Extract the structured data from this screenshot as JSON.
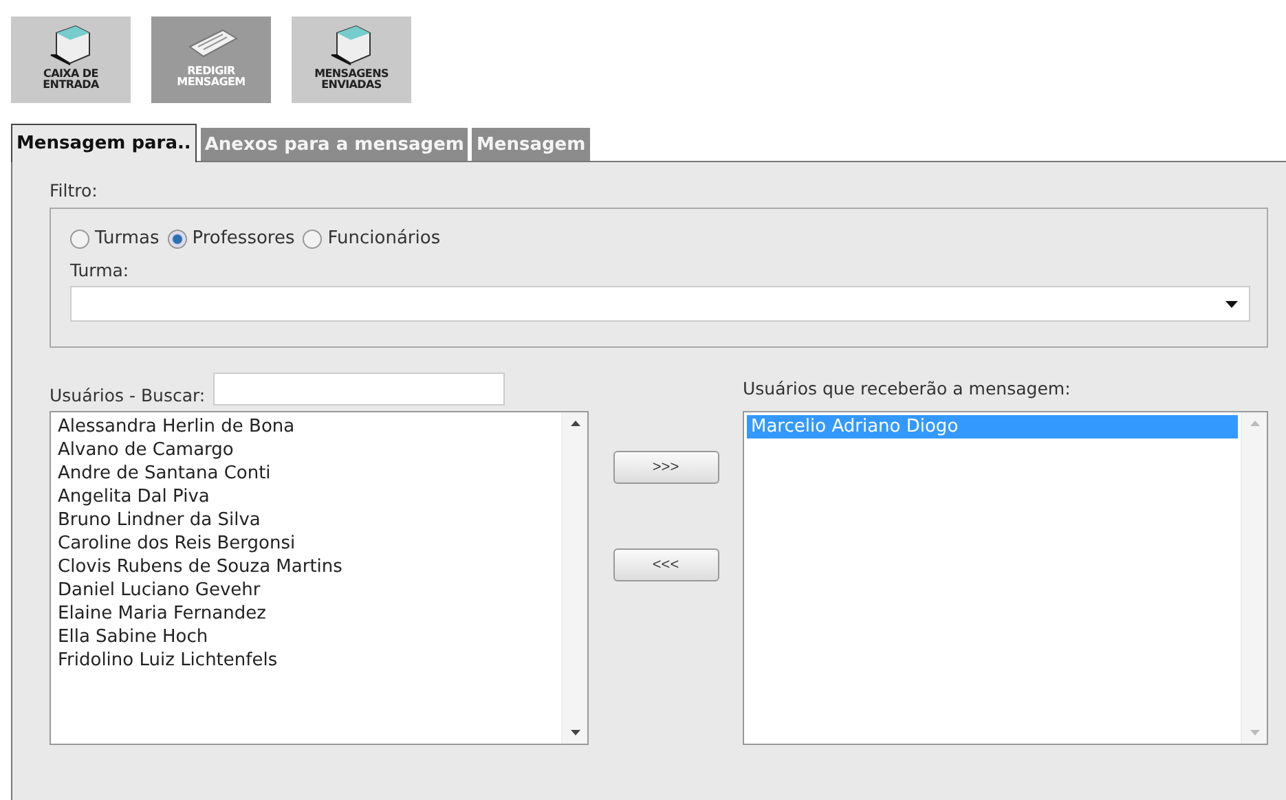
{
  "toolbar": [
    {
      "label": "CAIXA DE ENTRADA",
      "kind": "inbox",
      "disabled": false
    },
    {
      "label": "REDIGIR MENSAGEM",
      "kind": "compose",
      "disabled": true
    },
    {
      "label": "MENSAGENS ENVIADAS",
      "kind": "sent",
      "disabled": false
    }
  ],
  "tabs": [
    {
      "label": "Mensagem para..",
      "selected": true
    },
    {
      "label": "Anexos para a mensagem",
      "selected": false
    },
    {
      "label": "Mensagem",
      "selected": false
    }
  ],
  "filter": {
    "label": "Filtro:",
    "options": [
      {
        "label": "Turmas",
        "selected": false
      },
      {
        "label": "Professores",
        "selected": true
      },
      {
        "label": "Funcionários",
        "selected": false
      }
    ],
    "class_label": "Turma:"
  },
  "users": {
    "label": "Usuários - Buscar:",
    "items": [
      "Alessandra Herlin de Bona",
      "Alvano de Camargo",
      "Andre de Santana Conti",
      "Angelita Dal Piva",
      "Bruno Lindner da Silva",
      "Caroline dos Reis Bergonsi",
      "Clovis Rubens de Souza Martins",
      "Daniel Luciano Gevehr",
      "Elaine Maria Fernandez",
      "Ella Sabine Hoch",
      "Fridolino Luiz Lichtenfels"
    ]
  },
  "move_buttons": [
    ">>>",
    "<<<"
  ],
  "recipients": {
    "label": "Usuários que receberão a mensagem:",
    "items": [
      {
        "name": "Marcelio Adriano Diogo",
        "selected": true
      }
    ]
  }
}
